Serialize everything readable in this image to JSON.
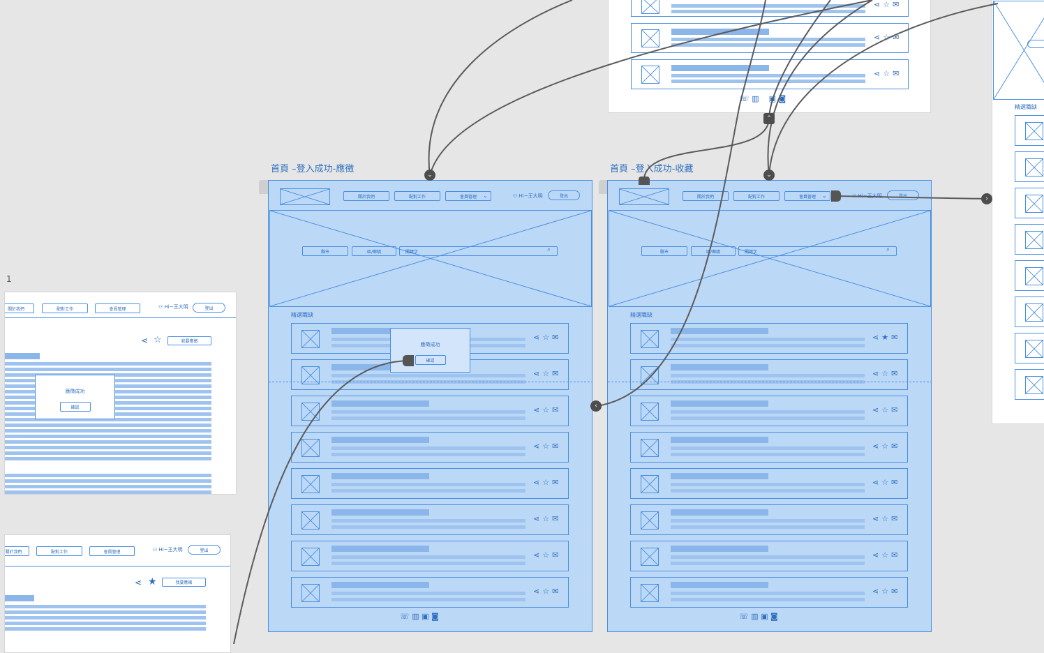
{
  "frames": {
    "left": {
      "title": "首頁 –登入成功-應徵",
      "nav": [
        "關於我們",
        "配對工作",
        "會員管理"
      ],
      "user": "Hi~王大明",
      "logout": "登出",
      "search": {
        "city": "縣市",
        "district": "區/鄉鎮",
        "keyword": "關鍵字"
      },
      "section": "精選職缺",
      "dialog": {
        "message": "應徵成功",
        "ok": "確認"
      }
    },
    "right": {
      "title": "首頁 –登入成功-收藏",
      "nav": [
        "關於我們",
        "配對工作",
        "會員管理"
      ],
      "user": "Hi~王大明",
      "logout": "登出",
      "search": {
        "city": "縣市",
        "district": "區/鄉鎮",
        "keyword": "關鍵字"
      },
      "section": "精選職缺"
    }
  },
  "side_left_top": {
    "number": "1",
    "nav": [
      "關於我們",
      "配對工作",
      "會員管理"
    ],
    "user": "Hi~王大明",
    "logout": "登出",
    "apply": "我要應徵",
    "dialog": {
      "message": "應徵成功",
      "ok": "確認"
    }
  },
  "side_left_bottom": {
    "nav": [
      "關於我們",
      "配對工作",
      "會員管理"
    ],
    "user": "Hi~王大明",
    "logout": "登出",
    "apply": "我要應徵"
  },
  "side_right": {
    "section": "精選職缺"
  },
  "colors": {
    "canvas": "#e6e6e6",
    "selection": "#bcd8f7",
    "wire": "#4a8fe0",
    "connector": "#555555"
  }
}
